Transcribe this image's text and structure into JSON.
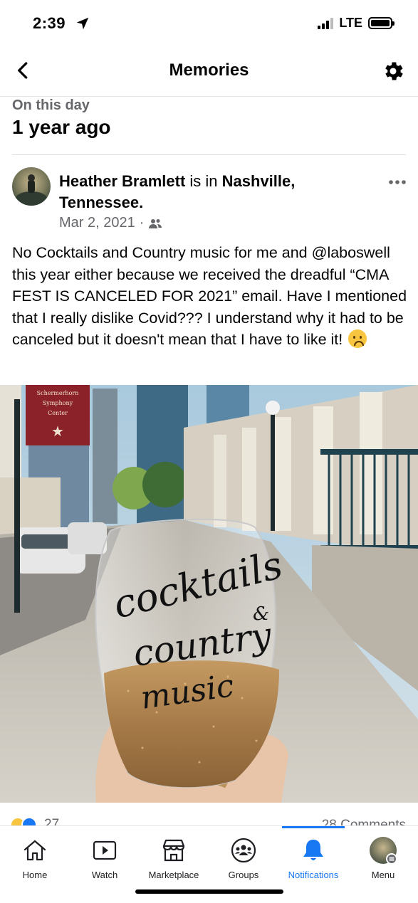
{
  "status_bar": {
    "time": "2:39",
    "network": "LTE",
    "location_icon": "location-arrow-icon",
    "signal_icon": "signal-bars-icon",
    "battery_icon": "battery-icon"
  },
  "nav": {
    "title": "Memories",
    "back_icon": "chevron-left-icon",
    "settings_icon": "gear-icon"
  },
  "memory": {
    "subtitle": "On this day",
    "title": "1 year ago"
  },
  "post": {
    "author": "Heather Bramlett",
    "connector": " is in ",
    "location": "Nashville, Tennessee.",
    "date": "Mar 2, 2021",
    "separator": "·",
    "audience_icon": "friends-icon",
    "more_icon": "more-horizontal-icon",
    "text": "No Cocktails and Country music for me and @laboswell this year either because we received the dreadful “CMA FEST IS CANCELED FOR 2021” email. Have I mentioned that I really dislike Covid??? I understand why it had to be canceled but it doesn't mean that I have to like it!",
    "emoji": "sad-face-emoji",
    "photo": {
      "sign_text": "Schermerhorn Symphony Center",
      "glass_text_line1": "cocktails",
      "glass_text_amp": "&",
      "glass_text_line2": "country",
      "glass_text_line3": "music"
    },
    "reactions": {
      "count": "27",
      "icons": [
        "haha-reaction-icon",
        "like-reaction-icon"
      ]
    },
    "comments": "28 Comments"
  },
  "tabbar": {
    "active": "Notifications",
    "tabs": [
      {
        "label": "Home",
        "icon": "home-icon"
      },
      {
        "label": "Watch",
        "icon": "watch-icon"
      },
      {
        "label": "Marketplace",
        "icon": "marketplace-icon"
      },
      {
        "label": "Groups",
        "icon": "groups-icon"
      },
      {
        "label": "Notifications",
        "icon": "bell-icon"
      },
      {
        "label": "Menu",
        "icon": "profile-avatar-icon"
      }
    ]
  },
  "colors": {
    "accent": "#1877f2",
    "secondary_text": "#65676b",
    "divider": "#dadde1"
  }
}
